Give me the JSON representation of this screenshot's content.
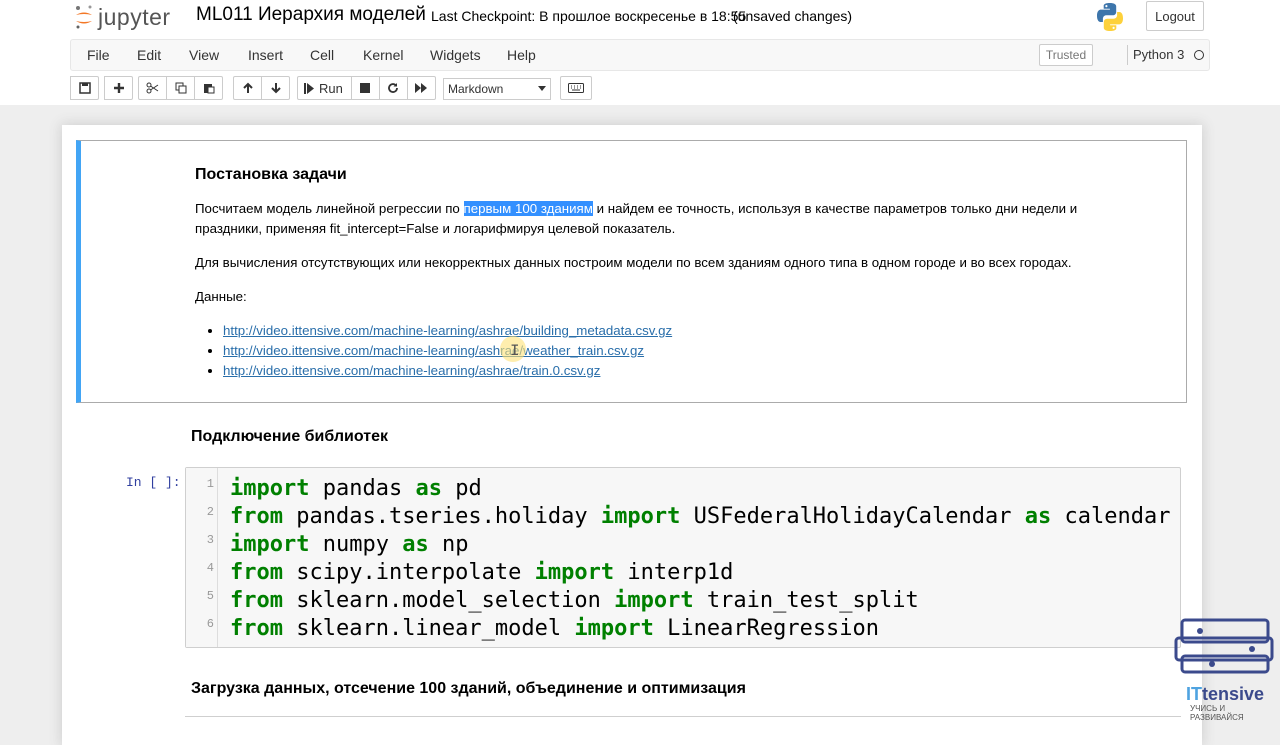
{
  "header": {
    "logo_text": "jupyter",
    "notebook_name": "ML011 Иерархия моделей",
    "checkpoint": "Last Checkpoint: В прошлое воскресенье в 18:55",
    "unsaved": "(unsaved changes)",
    "logout_label": "Logout"
  },
  "menubar": {
    "items": [
      "File",
      "Edit",
      "View",
      "Insert",
      "Cell",
      "Kernel",
      "Widgets",
      "Help"
    ],
    "trusted": "Trusted",
    "kernel": "Python 3"
  },
  "toolbar": {
    "run_label": "Run",
    "cell_type": "Markdown"
  },
  "cells": {
    "md1": {
      "heading": "Постановка задачи",
      "p1_before": "Посчитаем модель линейной регрессии по ",
      "p1_highlight": "первым 100 зданиям",
      "p1_after_line1": " и найдем ее точность, используя в качестве параметров только дни недели и",
      "p1_line2": "праздники, применяя fit_intercept=False и логарифмируя целевой показатель.",
      "p2": "Для вычисления отсутствующих или некорректных данных построим модели по всем зданиям одного типа в одном городе и во всех городах.",
      "p3": "Данные:",
      "links": [
        "http://video.ittensive.com/machine-learning/ashrae/building_metadata.csv.gz",
        "http://video.ittensive.com/machine-learning/ashrae/weather_train.csv.gz",
        "http://video.ittensive.com/machine-learning/ashrae/train.0.csv.gz"
      ]
    },
    "md2": {
      "heading": "Подключение библиотек"
    },
    "code1": {
      "prompt": "In [ ]:",
      "line_numbers": [
        "1",
        "2",
        "3",
        "4",
        "5",
        "6"
      ],
      "lines": [
        [
          [
            "kw",
            "import"
          ],
          [
            "t",
            " pandas "
          ],
          [
            "kw",
            "as"
          ],
          [
            "t",
            " pd"
          ]
        ],
        [
          [
            "kw",
            "from"
          ],
          [
            "t",
            " pandas.tseries.holiday "
          ],
          [
            "kw",
            "import"
          ],
          [
            "t",
            " USFederalHolidayCalendar "
          ],
          [
            "kw",
            "as"
          ],
          [
            "t",
            " calendar"
          ]
        ],
        [
          [
            "kw",
            "import"
          ],
          [
            "t",
            " numpy "
          ],
          [
            "kw",
            "as"
          ],
          [
            "t",
            " np"
          ]
        ],
        [
          [
            "kw",
            "from"
          ],
          [
            "t",
            " scipy.interpolate "
          ],
          [
            "kw",
            "import"
          ],
          [
            "t",
            " interp1d"
          ]
        ],
        [
          [
            "kw",
            "from"
          ],
          [
            "t",
            " sklearn.model_selection "
          ],
          [
            "kw",
            "import"
          ],
          [
            "t",
            " train_test_split"
          ]
        ],
        [
          [
            "kw",
            "from"
          ],
          [
            "t",
            " sklearn.linear_model "
          ],
          [
            "kw",
            "import"
          ],
          [
            "t",
            " LinearRegression"
          ]
        ]
      ]
    },
    "md3": {
      "heading": "Загрузка данных, отсечение 100 зданий, объединение и оптимизация"
    }
  },
  "watermark": {
    "brand_it": "IT",
    "brand_rest": "tensive",
    "tagline": "УЧИСЬ И РАЗВИВАЙСЯ"
  },
  "colors": {
    "selected_border": "#42a5f5",
    "keyword": "#008000",
    "link": "#296eaa",
    "highlight": "#3390ff"
  }
}
